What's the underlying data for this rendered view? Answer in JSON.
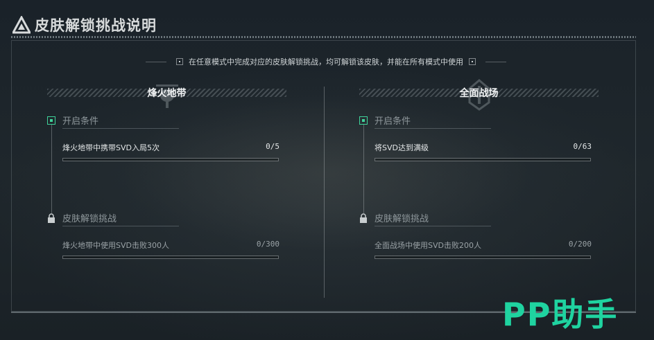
{
  "header": {
    "title": "皮肤解锁挑战说明"
  },
  "notice": "在任意模式中完成对应的皮肤解锁挑战，均可解锁该皮肤，并能在所有模式中使用",
  "columns": [
    {
      "name": "烽火地带",
      "unlock_condition": {
        "label": "开启条件",
        "task": "烽火地带中携带SVD入局5次",
        "progress": "0/5",
        "fraction": 0.0
      },
      "skin_challenge": {
        "label": "皮肤解锁挑战",
        "task": "烽火地带中使用SVD击败300人",
        "progress": "0/300",
        "fraction": 0.0
      }
    },
    {
      "name": "全面战场",
      "unlock_condition": {
        "label": "开启条件",
        "task": "将SVD达到满级",
        "progress": "0/63",
        "fraction": 0.0
      },
      "skin_challenge": {
        "label": "皮肤解锁挑战",
        "task": "全面战场中使用SVD击败200人",
        "progress": "0/200",
        "fraction": 0.0
      }
    }
  ],
  "watermark": "PP助手",
  "colors": {
    "accent": "#3fd39a",
    "watermark": "#1fd3a0",
    "background": "#1b2329"
  },
  "icons": {
    "header": "triangle-logo-icon",
    "condition": "square-marker-icon",
    "challenge": "lock-icon"
  }
}
